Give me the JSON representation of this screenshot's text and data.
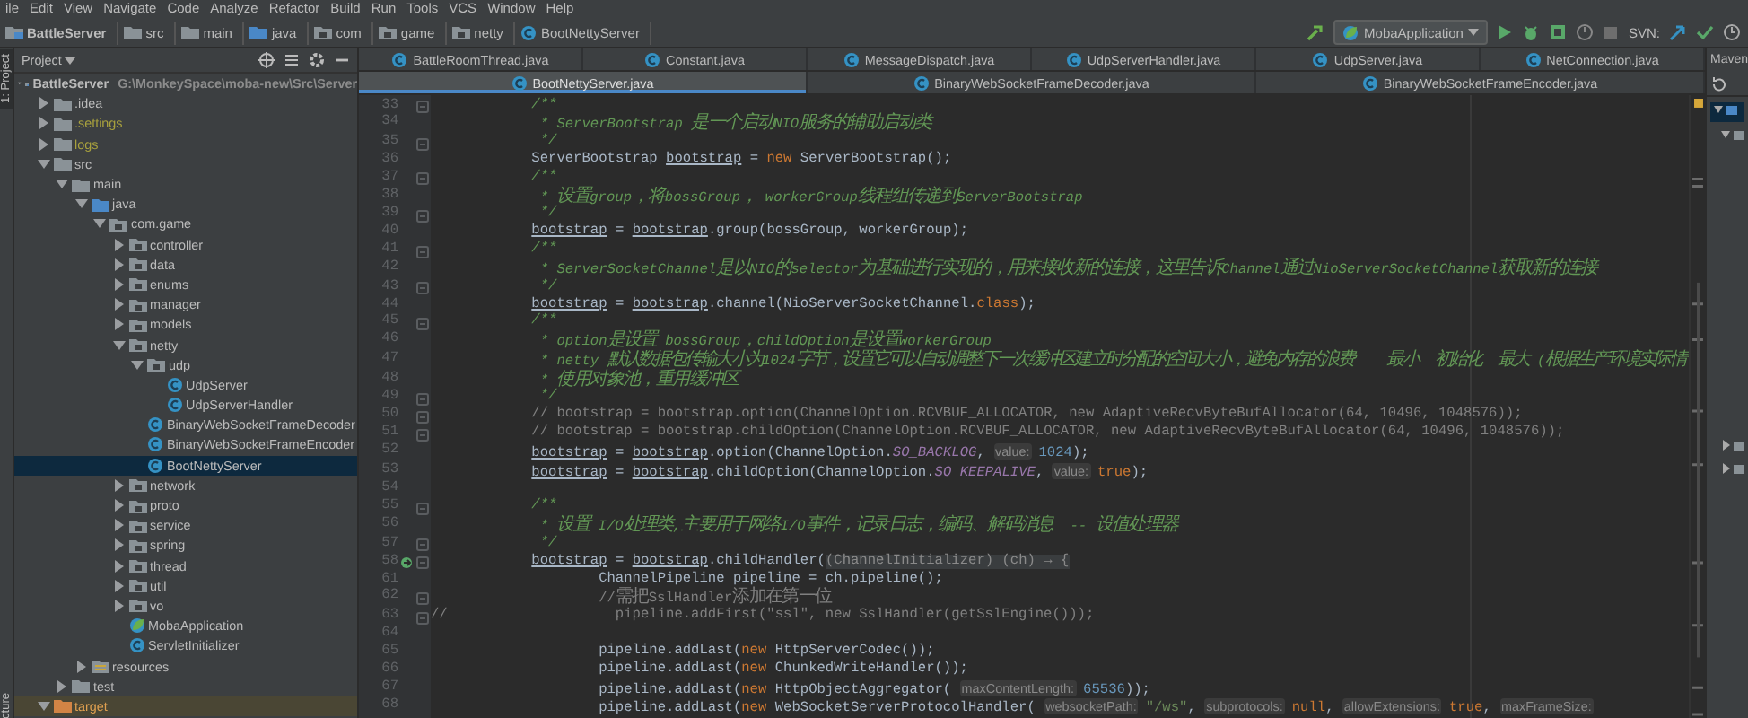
{
  "menu": [
    "ile",
    "Edit",
    "View",
    "Navigate",
    "Code",
    "Analyze",
    "Refactor",
    "Build",
    "Run",
    "Tools",
    "VCS",
    "Window",
    "Help"
  ],
  "breadcrumbs": [
    {
      "label": "BattleServer",
      "kind": "module"
    },
    {
      "label": "src",
      "kind": "folder"
    },
    {
      "label": "main",
      "kind": "folder"
    },
    {
      "label": "java",
      "kind": "source"
    },
    {
      "label": "com",
      "kind": "package"
    },
    {
      "label": "game",
      "kind": "package"
    },
    {
      "label": "netty",
      "kind": "package"
    },
    {
      "label": "BootNettyServer",
      "kind": "class"
    }
  ],
  "toolbar": {
    "run_config": "MobaApplication",
    "svn_label": "SVN:"
  },
  "tool_strip": {
    "top": "1: Project",
    "bottom": "cture"
  },
  "project": {
    "title": "Project",
    "tree": [
      {
        "label": "BattleServer",
        "path": "G:\\MonkeySpace\\moba-new\\Src\\Server",
        "kind": "module",
        "ignored": false,
        "expanded": true,
        "selected": false,
        "children": [
          {
            "label": ".idea",
            "kind": "folder",
            "ignored": false,
            "expanded": false,
            "selected": false
          },
          {
            "label": ".settings",
            "kind": "folder",
            "ignored": true,
            "expanded": false,
            "selected": false
          },
          {
            "label": "logs",
            "kind": "folder",
            "ignored": true,
            "expanded": false,
            "selected": false
          },
          {
            "label": "src",
            "kind": "folder",
            "ignored": false,
            "expanded": true,
            "selected": false,
            "children": [
              {
                "label": "main",
                "kind": "folder",
                "ignored": false,
                "expanded": true,
                "selected": false,
                "children": [
                  {
                    "label": "java",
                    "kind": "source",
                    "ignored": false,
                    "expanded": true,
                    "selected": false,
                    "children": [
                      {
                        "label": "com.game",
                        "kind": "package",
                        "ignored": false,
                        "expanded": true,
                        "selected": false,
                        "children": [
                          {
                            "label": "controller",
                            "kind": "package",
                            "ignored": false,
                            "expanded": false,
                            "selected": false
                          },
                          {
                            "label": "data",
                            "kind": "package",
                            "ignored": false,
                            "expanded": false,
                            "selected": false
                          },
                          {
                            "label": "enums",
                            "kind": "package",
                            "ignored": false,
                            "expanded": false,
                            "selected": false
                          },
                          {
                            "label": "manager",
                            "kind": "package",
                            "ignored": false,
                            "expanded": false,
                            "selected": false
                          },
                          {
                            "label": "models",
                            "kind": "package",
                            "ignored": false,
                            "expanded": false,
                            "selected": false
                          },
                          {
                            "label": "netty",
                            "kind": "package",
                            "ignored": false,
                            "expanded": true,
                            "selected": false,
                            "children": [
                              {
                                "label": "udp",
                                "kind": "package",
                                "ignored": false,
                                "expanded": true,
                                "selected": false,
                                "children": [
                                  {
                                    "label": "UdpServer",
                                    "kind": "class",
                                    "ignored": false,
                                    "selected": false
                                  },
                                  {
                                    "label": "UdpServerHandler",
                                    "kind": "class",
                                    "ignored": false,
                                    "selected": false
                                  }
                                ]
                              },
                              {
                                "label": "BinaryWebSocketFrameDecoder",
                                "kind": "class",
                                "ignored": false,
                                "selected": false
                              },
                              {
                                "label": "BinaryWebSocketFrameEncoder",
                                "kind": "class",
                                "ignored": false,
                                "selected": false
                              },
                              {
                                "label": "BootNettyServer",
                                "kind": "class",
                                "ignored": false,
                                "selected": true
                              }
                            ]
                          },
                          {
                            "label": "network",
                            "kind": "package",
                            "ignored": false,
                            "expanded": false,
                            "selected": false
                          },
                          {
                            "label": "proto",
                            "kind": "package",
                            "ignored": false,
                            "expanded": false,
                            "selected": false
                          },
                          {
                            "label": "service",
                            "kind": "package",
                            "ignored": false,
                            "expanded": false,
                            "selected": false
                          },
                          {
                            "label": "spring",
                            "kind": "package",
                            "ignored": false,
                            "expanded": false,
                            "selected": false
                          },
                          {
                            "label": "thread",
                            "kind": "package",
                            "ignored": false,
                            "expanded": false,
                            "selected": false
                          },
                          {
                            "label": "util",
                            "kind": "package",
                            "ignored": false,
                            "expanded": false,
                            "selected": false
                          },
                          {
                            "label": "vo",
                            "kind": "package",
                            "ignored": false,
                            "expanded": false,
                            "selected": false
                          },
                          {
                            "label": "MobaApplication",
                            "kind": "spring",
                            "ignored": false,
                            "selected": false
                          },
                          {
                            "label": "ServletInitializer",
                            "kind": "class",
                            "ignored": false,
                            "selected": false
                          }
                        ]
                      }
                    ]
                  },
                  {
                    "label": "resources",
                    "kind": "resources",
                    "ignored": false,
                    "expanded": false,
                    "selected": false
                  }
                ]
              },
              {
                "label": "test",
                "kind": "folder",
                "ignored": false,
                "expanded": false,
                "selected": false
              }
            ]
          },
          {
            "label": "target",
            "kind": "excluded",
            "ignored": false,
            "expanded": true,
            "selected": false
          }
        ]
      }
    ]
  },
  "tab_rows": [
    {
      "tabs": [
        {
          "label": "BattleRoomThread.java",
          "selected": false
        },
        {
          "label": "Constant.java",
          "selected": false
        },
        {
          "label": "MessageDispatch.java",
          "selected": false
        },
        {
          "label": "UdpServerHandler.java",
          "selected": false
        },
        {
          "label": "UdpServer.java",
          "selected": false
        },
        {
          "label": "NetConnection.java",
          "selected": false
        }
      ]
    },
    {
      "tabs": [
        {
          "label": "BootNettyServer.java",
          "selected": true
        },
        {
          "label": "BinaryWebSocketFrameDecoder.java",
          "selected": false
        },
        {
          "label": "BinaryWebSocketFrameEncoder.java",
          "selected": false
        }
      ]
    }
  ],
  "side_panel": {
    "title": "Maven"
  },
  "editor": {
    "lines": [
      {
        "number": "33",
        "fold": true,
        "gutter_icon": false,
        "kind": "outer",
        "code": [
          {
            "kind": "doc",
            "text": "/**"
          }
        ]
      },
      {
        "number": "34",
        "fold": false,
        "gutter_icon": false,
        "kind": "outer",
        "code": [
          {
            "kind": "doc",
            "text": " * ServerBootstrap 是一个启动NIO服务的辅助启动类"
          }
        ]
      },
      {
        "number": "35",
        "fold": true,
        "gutter_icon": false,
        "kind": "outer",
        "code": [
          {
            "kind": "doc",
            "text": " */"
          }
        ]
      },
      {
        "number": "36",
        "fold": false,
        "gutter_icon": false,
        "kind": "outer",
        "code": [
          "ServerBootstrap ",
          {
            "kind": "var",
            "text": "bootstrap"
          },
          " = ",
          {
            "kind": "keyword",
            "text": "new"
          },
          " ServerBootstrap();"
        ]
      },
      {
        "number": "37",
        "fold": true,
        "gutter_icon": false,
        "kind": "outer",
        "code": [
          {
            "kind": "doc",
            "text": "/**"
          }
        ]
      },
      {
        "number": "38",
        "fold": false,
        "gutter_icon": false,
        "kind": "outer",
        "code": [
          {
            "kind": "doc",
            "text": " * 设置group，将bossGroup， workerGroup线程组传递到ServerBootstrap"
          }
        ]
      },
      {
        "number": "39",
        "fold": true,
        "gutter_icon": false,
        "kind": "outer",
        "code": [
          {
            "kind": "doc",
            "text": " */"
          }
        ]
      },
      {
        "number": "40",
        "fold": false,
        "gutter_icon": false,
        "kind": "outer",
        "code": [
          {
            "kind": "var",
            "text": "bootstrap"
          },
          " = ",
          {
            "kind": "var",
            "text": "bootstrap"
          },
          ".group(bossGroup, workerGroup);"
        ]
      },
      {
        "number": "41",
        "fold": true,
        "gutter_icon": false,
        "kind": "outer",
        "code": [
          {
            "kind": "doc",
            "text": "/**"
          }
        ]
      },
      {
        "number": "42",
        "fold": false,
        "gutter_icon": false,
        "kind": "outer",
        "code": [
          {
            "kind": "doc",
            "text": " * ServerSocketChannel是以NIO的selector为基础进行实现的，用来接收新的连接，这里告诉Channel通过NioServerSocketChannel获取新的连接"
          }
        ]
      },
      {
        "number": "43",
        "fold": true,
        "gutter_icon": false,
        "kind": "outer",
        "code": [
          {
            "kind": "doc",
            "text": " */"
          }
        ]
      },
      {
        "number": "44",
        "fold": false,
        "gutter_icon": false,
        "kind": "outer",
        "code": [
          {
            "kind": "var",
            "text": "bootstrap"
          },
          " = ",
          {
            "kind": "var",
            "text": "bootstrap"
          },
          ".channel(NioServerSocketChannel.",
          {
            "kind": "keyword",
            "text": "class"
          },
          ");"
        ]
      },
      {
        "number": "45",
        "fold": true,
        "gutter_icon": false,
        "kind": "outer",
        "code": [
          {
            "kind": "doc",
            "text": "/**"
          }
        ]
      },
      {
        "number": "46",
        "fold": false,
        "gutter_icon": false,
        "kind": "outer",
        "code": [
          {
            "kind": "doc",
            "text": " * option是设置 bossGroup，childOption是设置workerGroup"
          }
        ]
      },
      {
        "number": "47",
        "fold": false,
        "gutter_icon": false,
        "kind": "outer",
        "code": [
          {
            "kind": "doc",
            "text": " * netty 默认数据包传输大小为1024字节，设置它可以自动调整下一次缓冲区建立时分配的空间大小，避免内存的浪费    最小  初始化  最大 (根据生产环境实际情"
          }
        ]
      },
      {
        "number": "48",
        "fold": false,
        "gutter_icon": false,
        "kind": "outer",
        "code": [
          {
            "kind": "doc",
            "text": " * 使用对象池，重用缓冲区"
          }
        ]
      },
      {
        "number": "49",
        "fold": true,
        "gutter_icon": false,
        "kind": "outer",
        "code": [
          {
            "kind": "doc",
            "text": " */"
          }
        ]
      },
      {
        "number": "50",
        "fold": true,
        "gutter_icon": false,
        "kind": "outer",
        "code": [
          {
            "kind": "comment",
            "text": "// bootstrap = bootstrap.option(ChannelOption.RCVBUF_ALLOCATOR, new AdaptiveRecvByteBufAllocator(64, 10496, 1048576));"
          }
        ]
      },
      {
        "number": "51",
        "fold": true,
        "gutter_icon": false,
        "kind": "outer",
        "code": [
          {
            "kind": "comment",
            "text": "// bootstrap = bootstrap.childOption(ChannelOption.RCVBUF_ALLOCATOR, new AdaptiveRecvByteBufAllocator(64, 10496, 1048576));"
          }
        ]
      },
      {
        "number": "52",
        "fold": false,
        "gutter_icon": false,
        "kind": "outer",
        "code": [
          {
            "kind": "var",
            "text": "bootstrap"
          },
          " = ",
          {
            "kind": "var",
            "text": "bootstrap"
          },
          ".option(ChannelOption.",
          {
            "kind": "field",
            "text": "SO_BACKLOG"
          },
          ", ",
          {
            "kind": "hint",
            "text": "value:"
          },
          {
            "kind": "number",
            "text": "1024"
          },
          ");"
        ]
      },
      {
        "number": "53",
        "fold": false,
        "gutter_icon": false,
        "kind": "outer",
        "code": [
          {
            "kind": "var",
            "text": "bootstrap"
          },
          " = ",
          {
            "kind": "var",
            "text": "bootstrap"
          },
          ".childOption(ChannelOption.",
          {
            "kind": "field",
            "text": "SO_KEEPALIVE"
          },
          ", ",
          {
            "kind": "hint",
            "text": "value:"
          },
          {
            "kind": "keyword",
            "text": "true"
          },
          ");"
        ]
      },
      {
        "number": "54",
        "fold": false,
        "gutter_icon": false
      },
      {
        "number": "55",
        "fold": true,
        "gutter_icon": false,
        "kind": "outer",
        "code": [
          {
            "kind": "doc",
            "text": "/**"
          }
        ]
      },
      {
        "number": "56",
        "fold": false,
        "gutter_icon": false,
        "kind": "outer",
        "code": [
          {
            "kind": "doc",
            "text": " * 设置 I/O处理类,主要用于网络I/O事件，记录日志，编码、解码消息  -- 设值处理器"
          }
        ]
      },
      {
        "number": "57",
        "fold": true,
        "gutter_icon": false,
        "kind": "outer",
        "code": [
          {
            "kind": "doc",
            "text": " */"
          }
        ]
      },
      {
        "number": "58",
        "fold": true,
        "gutter_icon": true,
        "kind": "outer",
        "code": [
          {
            "kind": "var",
            "text": "bootstrap"
          },
          " = ",
          {
            "kind": "var",
            "text": "bootstrap"
          },
          ".childHandler(",
          {
            "kind": "folded",
            "text": "(ChannelInitializer) (ch) → {"
          }
        ]
      },
      {
        "number": "61",
        "fold": false,
        "gutter_icon": false,
        "kind": "inner",
        "code": [
          "ChannelPipeline pipeline = ch.pipeline();"
        ]
      },
      {
        "number": "62",
        "fold": true,
        "gutter_icon": false,
        "kind": "inner",
        "code": [
          {
            "kind": "comment",
            "text": "//需把SslHandler添加在第一位"
          }
        ]
      },
      {
        "number": "63",
        "fold": true,
        "gutter_icon": false,
        "kind": "flush",
        "code": [
          {
            "kind": "comment",
            "text": "//                    pipeline.addFirst(\"ssl\", new SslHandler(getSslEngine()));"
          }
        ]
      },
      {
        "number": "64",
        "fold": false,
        "gutter_icon": false
      },
      {
        "number": "65",
        "fold": false,
        "gutter_icon": false,
        "kind": "inner",
        "code": [
          "pipeline.addLast(",
          {
            "kind": "keyword",
            "text": "new"
          },
          " HttpServerCodec());"
        ]
      },
      {
        "number": "66",
        "fold": false,
        "gutter_icon": false,
        "kind": "inner",
        "code": [
          "pipeline.addLast(",
          {
            "kind": "keyword",
            "text": "new"
          },
          " ChunkedWriteHandler());"
        ]
      },
      {
        "number": "67",
        "fold": false,
        "gutter_icon": false,
        "kind": "inner",
        "code": [
          "pipeline.addLast(",
          {
            "kind": "keyword",
            "text": "new"
          },
          " HttpObjectAggregator( ",
          {
            "kind": "hint",
            "text": "maxContentLength:"
          },
          {
            "kind": "number",
            "text": "65536"
          },
          "));"
        ]
      },
      {
        "number": "68",
        "fold": false,
        "gutter_icon": false,
        "kind": "inner",
        "code": [
          "pipeline.addLast(",
          {
            "kind": "keyword",
            "text": "new"
          },
          " WebSocketServerProtocolHandler( ",
          {
            "kind": "hint",
            "text": "websocketPath:"
          },
          {
            "kind": "string",
            "text": "\"/ws\""
          },
          ", ",
          {
            "kind": "hint",
            "text": "subprotocols:"
          },
          {
            "kind": "keyword",
            "text": "null"
          },
          ", ",
          {
            "kind": "hint",
            "text": "allowExtensions:"
          },
          {
            "kind": "keyword",
            "text": "true"
          },
          ", ",
          {
            "kind": "hint",
            "text": "maxFrameSize:"
          }
        ]
      }
    ]
  }
}
